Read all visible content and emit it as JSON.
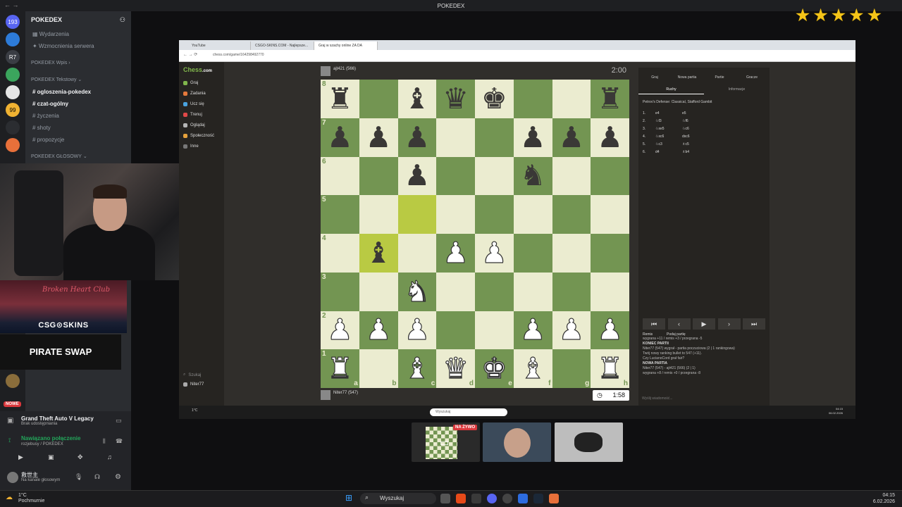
{
  "window": {
    "title": "POKEDEX",
    "nav": "← →",
    "controls": [
      "?",
      "—",
      "☐",
      "✕"
    ]
  },
  "stars": 5,
  "discord": {
    "server": "POKEDEX",
    "guild_badges": [
      "193",
      "",
      "R7",
      "",
      "",
      "99",
      "",
      "",
      ""
    ],
    "channels_top": [
      "Wydarzenia",
      "Wzmocnienia serwera"
    ],
    "cat_wpis": "POKEDEX Wpis",
    "cat_tekstowe": "POKEDEX Tekstowy",
    "text_channels": [
      "ogloszenia-pokedex",
      "czat-ogólny",
      "życzenia",
      "shoty",
      "propozycje"
    ],
    "cat_glosowy": "POKEDEX GŁOSOWY",
    "new_badge": "NOWE",
    "activity_title": "Grand Theft Auto V Legacy",
    "activity_sub": "Brak udostępniania",
    "voice_status": "Nawiązano połączenie",
    "voice_channel": "rozjebusy / POKEDEX",
    "user_name": "救世主",
    "user_status": "Na kanale głosowym"
  },
  "banners": {
    "club": "Broken Heart Club",
    "csg": "CSG⊙SKINS",
    "pirate": "PIRATE SWAP"
  },
  "browser": {
    "tabs": [
      "YouTube",
      "CSGO-SKINS.COM - Najlepsze...",
      "Graj w szachy online ZA DA"
    ],
    "url": "chess.com/game/164298492770",
    "site_logo_a": "Chess",
    "site_logo_b": ".com",
    "nav": [
      "Graj",
      "Zadania",
      "Ucz się",
      "Trenuj",
      "Oglądaj",
      "Społeczność",
      "Inne"
    ],
    "nav_bottom": [
      "Szukaj",
      "Niter77"
    ],
    "top_player": "ajt421 (566)",
    "top_clock": "2:00",
    "bottom_player": "Niter77 (547)",
    "bottom_clock": "1:58",
    "right_tabs": [
      "Graj",
      "Nowa partia",
      "Partie",
      "Gracze"
    ],
    "sub_tabs": [
      "Ruchy",
      "Informacje"
    ],
    "opening": "Petrov's Defense: Classical, Stafford Gambit",
    "moves": [
      [
        "1.",
        "e4",
        "e5"
      ],
      [
        "2.",
        "♘f3",
        "♘f6"
      ],
      [
        "3.",
        "♘xe5",
        "♘c6"
      ],
      [
        "4.",
        "♘xc6",
        "dxc6"
      ],
      [
        "5.",
        "♘c3",
        "♗c5"
      ],
      [
        "6.",
        "d4",
        "♗b4"
      ]
    ],
    "mv_controls": [
      "⏮",
      "‹",
      "▶",
      "›",
      "⏭"
    ],
    "footer_tabs": [
      "Remis",
      "Podaj partię"
    ],
    "chat": [
      "wygrana +11 / remis +3 / przegrana -5",
      "KONIEC PARTII",
      "Niter77 (547) wygrał - partia poczuciowa (2 | 1 rankingowa)",
      "Twój nowy ranking bullet to 547 (+11).",
      "Czy LucianoCord grał fair?",
      "NOWA PARTIA",
      "Niter77 (547) - ajt421 (566) (2 | 1)",
      "wygrana +8 / remis +0 / przegrana -8"
    ],
    "chat_input": "Wyślij wiadomość...",
    "search_placeholder": "Wyszukaj",
    "taskbar_time": "04:15",
    "taskbar_date": "06.02.2026"
  },
  "board": {
    "rows": [
      [
        "bR",
        "",
        "bB",
        "bQ",
        "bK",
        "",
        "",
        "bR"
      ],
      [
        "bP",
        "bP",
        "bP",
        "",
        "",
        "bP",
        "bP",
        "bP"
      ],
      [
        "",
        "",
        "bP",
        "",
        "",
        "bN",
        "",
        ""
      ],
      [
        "",
        "",
        "hl",
        "",
        "",
        "",
        "",
        ""
      ],
      [
        "",
        "hbB",
        "",
        "wP",
        "wP",
        "",
        "",
        ""
      ],
      [
        "",
        "",
        "wN",
        "",
        "",
        "",
        "",
        ""
      ],
      [
        "wP",
        "wP",
        "wP",
        "",
        "",
        "wP",
        "wP",
        "wP"
      ],
      [
        "wR",
        "",
        "wB",
        "wQ",
        "wK",
        "wB",
        "",
        "wR"
      ]
    ],
    "ranks": [
      "8",
      "7",
      "6",
      "5",
      "4",
      "3",
      "2",
      "1"
    ],
    "files": [
      "a",
      "b",
      "c",
      "d",
      "e",
      "f",
      "g",
      "h"
    ]
  },
  "call": {
    "live_badge": "NA ŻYWO"
  },
  "taskbar": {
    "weather_temp": "1°C",
    "weather_desc": "Pochmurnie",
    "search": "Wyszukaj",
    "time": "04:15",
    "date": "6.02.2026"
  }
}
